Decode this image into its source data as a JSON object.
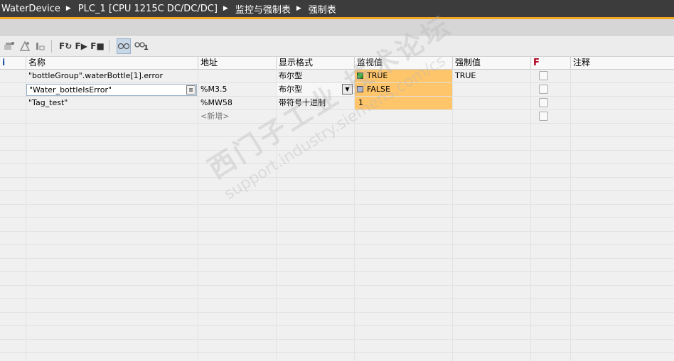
{
  "breadcrumb": {
    "items": [
      "WaterDevice",
      "PLC_1 [CPU 1215C DC/DC/DC]",
      "监控与强制表",
      "强制表"
    ]
  },
  "toolbar": {
    "icons": [
      "force-toggle-icon",
      "stop-force-icon",
      "force-load-icon",
      "force-update-icon",
      "force-step-icon",
      "force-stop-icon",
      "monitor-all-icon",
      "monitor-once-icon"
    ],
    "labels": {
      "b3": "F↻",
      "b4": "F▶",
      "b5": "F■",
      "b7": "1"
    }
  },
  "table": {
    "headers": {
      "index": "i",
      "name": "名称",
      "address": "地址",
      "format": "显示格式",
      "monitor": "监视值",
      "force": "强制值",
      "f": "F",
      "comment": "注释"
    },
    "rows": [
      {
        "name": "\"bottleGroup\".waterBottle[1].error",
        "address": "",
        "format": "布尔型",
        "monitor": "TRUE",
        "monitor_indicator": "#22aa22",
        "force": "TRUE"
      },
      {
        "name": "\"Water_bottleIsError\"",
        "address": "%M3.5",
        "format": "布尔型",
        "monitor": "FALSE",
        "monitor_indicator": "#aab4d8",
        "force": ""
      },
      {
        "name": "\"Tag_test\"",
        "address": "%MW58",
        "format": "带符号十进制",
        "monitor": "1",
        "force": ""
      }
    ],
    "new_row": "<新增>"
  },
  "watermark": {
    "line1": "西门子工业 技术论坛",
    "line2": "support.industry.siemens.com/cs"
  },
  "colors": {
    "accent": "#f5a623",
    "monitor_bg": "#ffc56a",
    "title_bg": "#3c3c3c"
  }
}
